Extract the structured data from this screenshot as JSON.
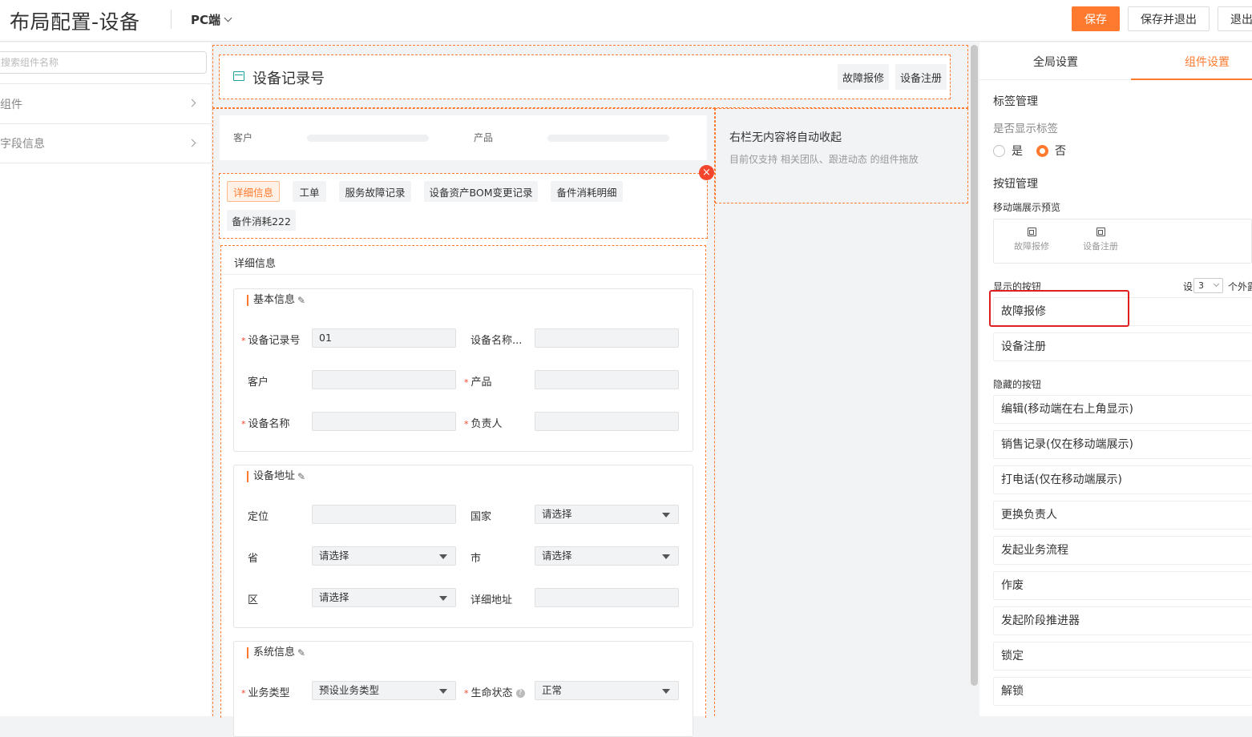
{
  "header": {
    "title": "布局配置-设备",
    "platform": "PC端",
    "save": "保存",
    "save_exit": "保存并退出",
    "exit": "退出"
  },
  "left": {
    "search_placeholder": "搜索组件名称",
    "items": [
      "组件",
      "字段信息"
    ]
  },
  "record_header": {
    "title": "设备记录号",
    "buttons": [
      "故障报修",
      "设备注册"
    ]
  },
  "summary": {
    "fields": [
      "客户",
      "产品"
    ]
  },
  "right_empty": {
    "title": "右栏无内容将自动收起",
    "subtitle": "目前仅支持 相关团队、跟进动态 的组件拖放"
  },
  "tabs": [
    "详细信息",
    "工单",
    "服务故障记录",
    "设备资产BOM变更记录",
    "备件消耗明细",
    "备件消耗222"
  ],
  "detail": {
    "label": "详细信息",
    "sections": [
      {
        "title": "基本信息",
        "fields": [
          {
            "label": "设备记录号",
            "value": "01",
            "required": true
          },
          {
            "label": "设备名称...",
            "value": "",
            "required": false
          },
          {
            "label": "客户",
            "value": "",
            "required": false
          },
          {
            "label": "产品",
            "value": "",
            "required": true
          },
          {
            "label": "设备名称",
            "value": "",
            "required": true
          },
          {
            "label": "负责人",
            "value": "",
            "required": true
          }
        ]
      },
      {
        "title": "设备地址",
        "fields": [
          {
            "label": "定位",
            "value": ""
          },
          {
            "label": "国家",
            "value": "请选择"
          },
          {
            "label": "省",
            "value": "请选择"
          },
          {
            "label": "市",
            "value": "请选择"
          },
          {
            "label": "区",
            "value": "请选择"
          },
          {
            "label": "详细地址",
            "value": ""
          }
        ]
      },
      {
        "title": "系统信息",
        "fields": [
          {
            "label": "业务类型",
            "value": "预设业务类型",
            "required": true
          },
          {
            "label": "生命状态",
            "value": "正常",
            "required": true
          }
        ]
      }
    ]
  },
  "right_panel": {
    "tabs": [
      "全局设置",
      "组件设置"
    ],
    "active_tab": "组件设置",
    "tag_mgmt": "标签管理",
    "show_tag_q": "是否显示标签",
    "radio_yes": "是",
    "radio_no": "否",
    "selected": "否",
    "button_mgmt": "按钮管理",
    "mobile_preview": "移动端展示预览",
    "preview_buttons": [
      "故障报修",
      "设备注册"
    ],
    "shown_buttons_label": "显示的按钮",
    "set_label": "设",
    "count": "3",
    "external_label": "个外露",
    "shown_buttons": [
      "故障报修",
      "设备注册"
    ],
    "hidden_buttons_label": "隐藏的按钮",
    "hidden_buttons": [
      "编辑(移动端在右上角显示)",
      "销售记录(仅在移动端展示)",
      "打电话(仅在移动端展示)",
      "更换负责人",
      "发起业务流程",
      "作废",
      "发起阶段推进器",
      "锁定",
      "解锁"
    ]
  },
  "colors": {
    "accent": "#ff7a2e",
    "highlight": "#e02020",
    "danger": "#f5452d"
  }
}
